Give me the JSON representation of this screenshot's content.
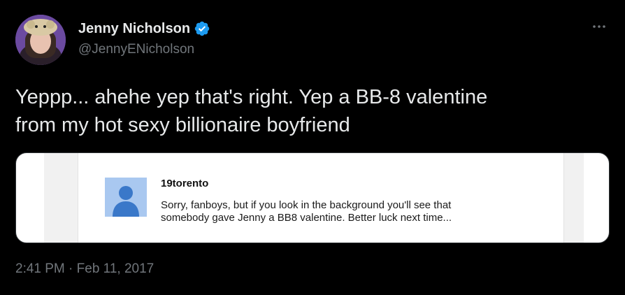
{
  "author": {
    "display_name": "Jenny Nicholson",
    "handle": "@JennyENicholson",
    "verified": true,
    "avatar_icon": "profile-photo"
  },
  "more_icon": "ellipsis-icon",
  "tweet": {
    "text": "Yeppp... ahehe yep that's right. Yep a BB-8 valentine\nfrom my hot sexy billionaire boyfriend"
  },
  "media": {
    "comment_user": "19torento",
    "comment_text": "Sorry, fanboys, but if you look in the background you'll see that\nsomebody gave Jenny a BB8 valentine. Better luck next time...",
    "avatar_icon": "default-user-icon"
  },
  "timestamp": "2:41 PM · Feb 11, 2017",
  "colors": {
    "background": "#000000",
    "text_primary": "#e7e9ea",
    "text_secondary": "#71767b",
    "verified_badge": "#1d9bf0"
  }
}
